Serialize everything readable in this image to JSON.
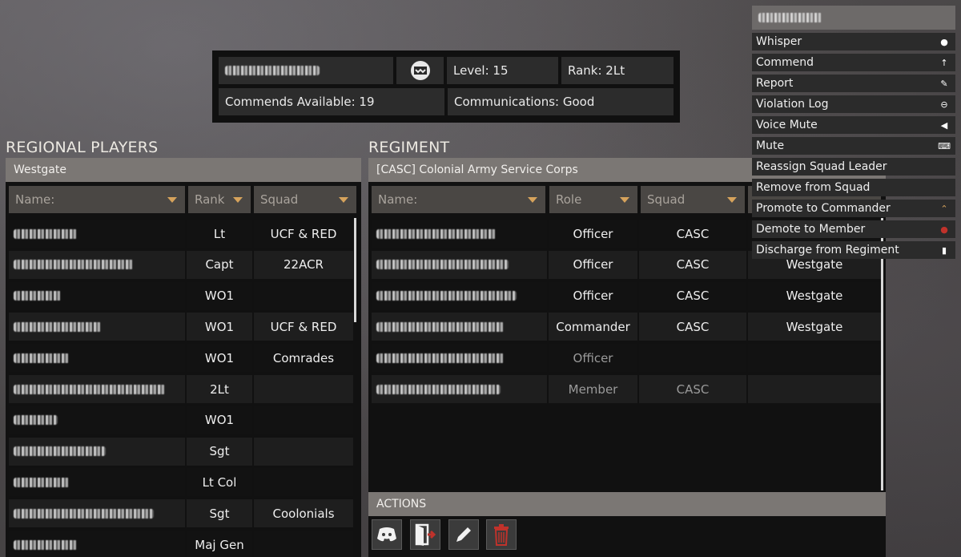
{
  "player": {
    "level": "Level: 15",
    "rank": "Rank: 2Lt",
    "commends": "Commends Available: 19",
    "communications": "Communications: Good"
  },
  "regional": {
    "title": "REGIONAL PLAYERS",
    "region": "Westgate",
    "columns": {
      "name": "Name:",
      "rank": "Rank",
      "squad": "Squad"
    },
    "rows": [
      {
        "rank": "Lt",
        "squad": "UCF & RED"
      },
      {
        "rank": "Capt",
        "squad": "22ACR"
      },
      {
        "rank": "WO1",
        "squad": ""
      },
      {
        "rank": "WO1",
        "squad": "UCF & RED"
      },
      {
        "rank": "WO1",
        "squad": "Comrades"
      },
      {
        "rank": "2Lt",
        "squad": ""
      },
      {
        "rank": "WO1",
        "squad": ""
      },
      {
        "rank": "Sgt",
        "squad": ""
      },
      {
        "rank": "Lt Col",
        "squad": ""
      },
      {
        "rank": "Sgt",
        "squad": "Coolonials"
      },
      {
        "rank": "Maj Gen",
        "squad": ""
      }
    ]
  },
  "regiment": {
    "title": "REGIMENT",
    "name": "[CASC] Colonial Army Service Corps",
    "columns": {
      "name": "Name:",
      "role": "Role",
      "squad": "Squad"
    },
    "rows": [
      {
        "role": "Officer",
        "squad": "CASC",
        "region": ""
      },
      {
        "role": "Officer",
        "squad": "CASC",
        "region": "Westgate"
      },
      {
        "role": "Officer",
        "squad": "CASC",
        "region": "Westgate"
      },
      {
        "role": "Commander",
        "squad": "CASC",
        "region": "Westgate"
      },
      {
        "role": "Officer",
        "squad": "",
        "region": ""
      },
      {
        "role": "Member",
        "squad": "CASC",
        "region": ""
      }
    ],
    "actions_label": "ACTIONS",
    "actions": [
      "discord-icon",
      "leave-door-icon",
      "edit-pencil-icon",
      "delete-trash-icon"
    ]
  },
  "menu": {
    "items": [
      {
        "label": "Whisper",
        "icon": "chat-bubble-icon"
      },
      {
        "label": "Commend",
        "icon": "arrow-up-icon"
      },
      {
        "label": "Report",
        "icon": "report-icon"
      },
      {
        "label": "Violation Log",
        "icon": "minus-circle-icon"
      },
      {
        "label": "Voice Mute",
        "icon": "speaker-icon"
      },
      {
        "label": "Mute",
        "icon": "keyboard-icon"
      },
      {
        "label": "Reassign Squad Leader",
        "icon": ""
      },
      {
        "label": "Remove from Squad",
        "icon": ""
      },
      {
        "label": "Promote to Commander",
        "icon": "chevrons-up-icon"
      },
      {
        "label": "Demote to Member",
        "icon": "demote-icon"
      },
      {
        "label": "Discharge from Regiment",
        "icon": "exit-door-icon"
      }
    ]
  },
  "colors": {
    "accent": "#d6a35c",
    "delete": "#c0322b"
  }
}
